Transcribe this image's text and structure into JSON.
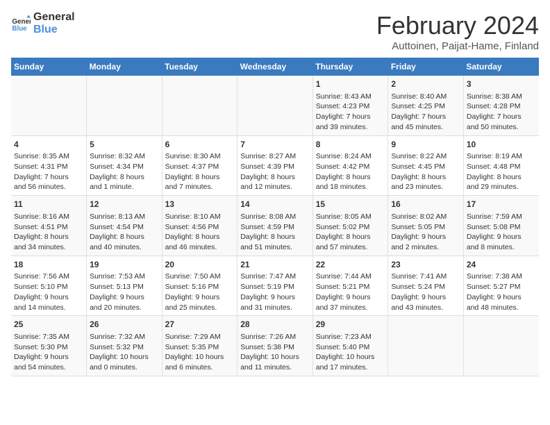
{
  "logo": {
    "line1": "General",
    "line2": "Blue"
  },
  "title": "February 2024",
  "subtitle": "Auttoinen, Paijat-Hame, Finland",
  "days_of_week": [
    "Sunday",
    "Monday",
    "Tuesday",
    "Wednesday",
    "Thursday",
    "Friday",
    "Saturday"
  ],
  "weeks": [
    [
      {
        "day": "",
        "info": ""
      },
      {
        "day": "",
        "info": ""
      },
      {
        "day": "",
        "info": ""
      },
      {
        "day": "",
        "info": ""
      },
      {
        "day": "1",
        "info": "Sunrise: 8:43 AM\nSunset: 4:23 PM\nDaylight: 7 hours\nand 39 minutes."
      },
      {
        "day": "2",
        "info": "Sunrise: 8:40 AM\nSunset: 4:25 PM\nDaylight: 7 hours\nand 45 minutes."
      },
      {
        "day": "3",
        "info": "Sunrise: 8:38 AM\nSunset: 4:28 PM\nDaylight: 7 hours\nand 50 minutes."
      }
    ],
    [
      {
        "day": "4",
        "info": "Sunrise: 8:35 AM\nSunset: 4:31 PM\nDaylight: 7 hours\nand 56 minutes."
      },
      {
        "day": "5",
        "info": "Sunrise: 8:32 AM\nSunset: 4:34 PM\nDaylight: 8 hours\nand 1 minute."
      },
      {
        "day": "6",
        "info": "Sunrise: 8:30 AM\nSunset: 4:37 PM\nDaylight: 8 hours\nand 7 minutes."
      },
      {
        "day": "7",
        "info": "Sunrise: 8:27 AM\nSunset: 4:39 PM\nDaylight: 8 hours\nand 12 minutes."
      },
      {
        "day": "8",
        "info": "Sunrise: 8:24 AM\nSunset: 4:42 PM\nDaylight: 8 hours\nand 18 minutes."
      },
      {
        "day": "9",
        "info": "Sunrise: 8:22 AM\nSunset: 4:45 PM\nDaylight: 8 hours\nand 23 minutes."
      },
      {
        "day": "10",
        "info": "Sunrise: 8:19 AM\nSunset: 4:48 PM\nDaylight: 8 hours\nand 29 minutes."
      }
    ],
    [
      {
        "day": "11",
        "info": "Sunrise: 8:16 AM\nSunset: 4:51 PM\nDaylight: 8 hours\nand 34 minutes."
      },
      {
        "day": "12",
        "info": "Sunrise: 8:13 AM\nSunset: 4:54 PM\nDaylight: 8 hours\nand 40 minutes."
      },
      {
        "day": "13",
        "info": "Sunrise: 8:10 AM\nSunset: 4:56 PM\nDaylight: 8 hours\nand 46 minutes."
      },
      {
        "day": "14",
        "info": "Sunrise: 8:08 AM\nSunset: 4:59 PM\nDaylight: 8 hours\nand 51 minutes."
      },
      {
        "day": "15",
        "info": "Sunrise: 8:05 AM\nSunset: 5:02 PM\nDaylight: 8 hours\nand 57 minutes."
      },
      {
        "day": "16",
        "info": "Sunrise: 8:02 AM\nSunset: 5:05 PM\nDaylight: 9 hours\nand 2 minutes."
      },
      {
        "day": "17",
        "info": "Sunrise: 7:59 AM\nSunset: 5:08 PM\nDaylight: 9 hours\nand 8 minutes."
      }
    ],
    [
      {
        "day": "18",
        "info": "Sunrise: 7:56 AM\nSunset: 5:10 PM\nDaylight: 9 hours\nand 14 minutes."
      },
      {
        "day": "19",
        "info": "Sunrise: 7:53 AM\nSunset: 5:13 PM\nDaylight: 9 hours\nand 20 minutes."
      },
      {
        "day": "20",
        "info": "Sunrise: 7:50 AM\nSunset: 5:16 PM\nDaylight: 9 hours\nand 25 minutes."
      },
      {
        "day": "21",
        "info": "Sunrise: 7:47 AM\nSunset: 5:19 PM\nDaylight: 9 hours\nand 31 minutes."
      },
      {
        "day": "22",
        "info": "Sunrise: 7:44 AM\nSunset: 5:21 PM\nDaylight: 9 hours\nand 37 minutes."
      },
      {
        "day": "23",
        "info": "Sunrise: 7:41 AM\nSunset: 5:24 PM\nDaylight: 9 hours\nand 43 minutes."
      },
      {
        "day": "24",
        "info": "Sunrise: 7:38 AM\nSunset: 5:27 PM\nDaylight: 9 hours\nand 48 minutes."
      }
    ],
    [
      {
        "day": "25",
        "info": "Sunrise: 7:35 AM\nSunset: 5:30 PM\nDaylight: 9 hours\nand 54 minutes."
      },
      {
        "day": "26",
        "info": "Sunrise: 7:32 AM\nSunset: 5:32 PM\nDaylight: 10 hours\nand 0 minutes."
      },
      {
        "day": "27",
        "info": "Sunrise: 7:29 AM\nSunset: 5:35 PM\nDaylight: 10 hours\nand 6 minutes."
      },
      {
        "day": "28",
        "info": "Sunrise: 7:26 AM\nSunset: 5:38 PM\nDaylight: 10 hours\nand 11 minutes."
      },
      {
        "day": "29",
        "info": "Sunrise: 7:23 AM\nSunset: 5:40 PM\nDaylight: 10 hours\nand 17 minutes."
      },
      {
        "day": "",
        "info": ""
      },
      {
        "day": "",
        "info": ""
      }
    ]
  ]
}
